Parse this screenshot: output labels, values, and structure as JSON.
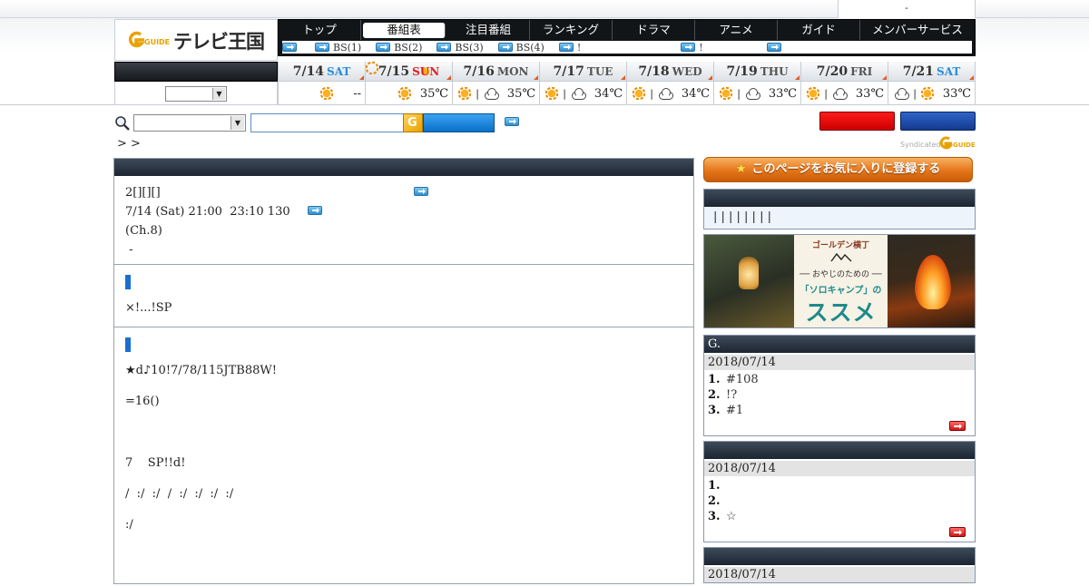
{
  "topbar": {
    "right_text": "-"
  },
  "logo": {
    "text": "テレビ王国",
    "g_text": "G GUIDE"
  },
  "nav": {
    "tabs": [
      "トップ",
      "番組表",
      "注目番組",
      "ランキング",
      "ドラマ",
      "アニメ",
      "ガイド",
      "メンバーサービス"
    ],
    "active_tab": 1,
    "sub_items": [
      "",
      "BS(1)",
      "BS(2)",
      "BS(3)",
      "BS(4)",
      "!",
      "!",
      ""
    ]
  },
  "days": [
    {
      "date": "7/14",
      "dow": "SAT",
      "dow_type": "sat",
      "weather": [
        "sun"
      ],
      "temp": "--"
    },
    {
      "date": "7/15",
      "dow": "SUN",
      "dow_type": "sun",
      "weather": [
        "sun"
      ],
      "temp": "35℃"
    },
    {
      "date": "7/16",
      "dow": "MON",
      "dow_type": "weekday",
      "weather": [
        "sun",
        "cloud"
      ],
      "temp": "35℃"
    },
    {
      "date": "7/17",
      "dow": "TUE",
      "dow_type": "weekday",
      "weather": [
        "sun",
        "cloud"
      ],
      "temp": "34℃"
    },
    {
      "date": "7/18",
      "dow": "WED",
      "dow_type": "weekday",
      "weather": [
        "sun",
        "cloud"
      ],
      "temp": "34℃"
    },
    {
      "date": "7/19",
      "dow": "THU",
      "dow_type": "weekday",
      "weather": [
        "sun",
        "cloud"
      ],
      "temp": "33℃"
    },
    {
      "date": "7/20",
      "dow": "FRI",
      "dow_type": "weekday",
      "weather": [
        "sun",
        "cloud"
      ],
      "temp": "33℃"
    },
    {
      "date": "7/21",
      "dow": "SAT",
      "dow_type": "sat",
      "weather": [
        "cloud",
        "sun"
      ],
      "temp": "33℃"
    }
  ],
  "weather_separator": "|",
  "breadcrumb": ">  >",
  "syndicated": {
    "label": "Syndicated",
    "g_text": "G GUIDE"
  },
  "program": {
    "title_line": "2[][][]",
    "time_line": "7/14 (Sat) 21:00  23:10 130",
    "channel_line": "(Ch.8)",
    "dash_line": " -",
    "section2_text": "×!...!SP",
    "section3_lines": [
      "★d♪10!7/78/115JTB88W!",
      "=16()",
      "",
      "7    SP!!d!",
      "/  :/  :/  /  :/  :/  :/  :/",
      ":/"
    ]
  },
  "sidebar": {
    "fav_button": "このページをお気に入りに登録する",
    "genre_links": "| | | | | | | |",
    "banner": {
      "brand": "ゴールデン横丁",
      "sub": "── おやじのための ──",
      "solo": "「ソロキャンプ」の",
      "susume": "ススメ"
    },
    "rankings": [
      {
        "title": "G.",
        "date": "2018/07/14",
        "items": [
          {
            "n": "1.",
            "t": "#108"
          },
          {
            "n": "2.",
            "t": "!?"
          },
          {
            "n": "3.",
            "t": "#1"
          }
        ]
      },
      {
        "title": "",
        "date": "2018/07/14",
        "items": [
          {
            "n": "1.",
            "t": ""
          },
          {
            "n": "2.",
            "t": ""
          },
          {
            "n": "3.",
            "t": "☆"
          }
        ]
      },
      {
        "title": "",
        "date": "2018/07/14",
        "items": []
      }
    ]
  }
}
